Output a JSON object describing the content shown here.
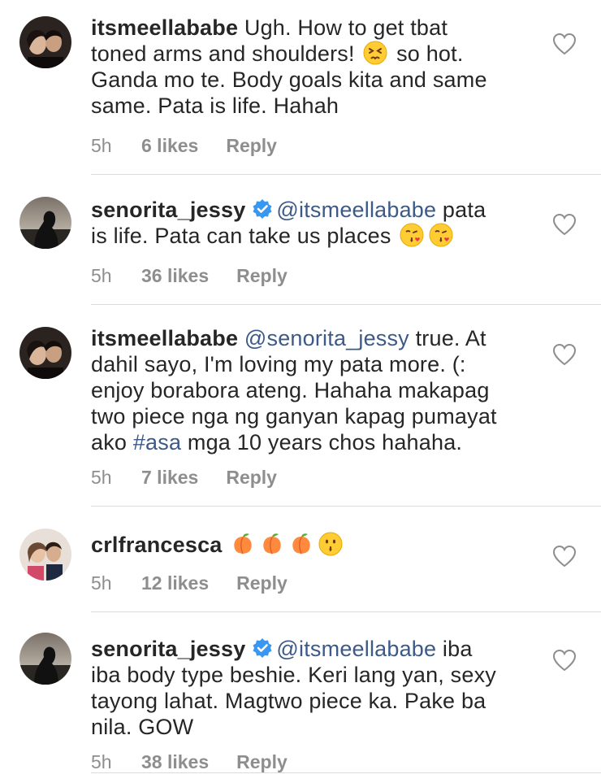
{
  "comments": [
    {
      "avatar_icon": "avatar-photo-couple",
      "username": "itsmeellababe",
      "verified": false,
      "lines": [
        [
          "Ugh. How to get tbat"
        ],
        [
          "toned arms and shoulders! ",
          "{emoji:persevering-face}",
          " so hot."
        ],
        [
          "Ganda mo te. Body goals kita and same"
        ],
        [
          "same. Pata is life. Hahah"
        ]
      ],
      "time": "5h",
      "likes": "6 likes",
      "reply": "Reply"
    },
    {
      "avatar_icon": "avatar-photo-silhouette",
      "username": "senorita_jessy",
      "verified": true,
      "lines": [
        [
          "{mention:@itsmeellababe}",
          " pata"
        ],
        [
          "is life. Pata can take us places ",
          "{emoji:face-blowing-kiss}",
          "{emoji:face-blowing-kiss}"
        ]
      ],
      "time": "5h",
      "likes": "36 likes",
      "reply": "Reply"
    },
    {
      "avatar_icon": "avatar-photo-couple",
      "username": "itsmeellababe",
      "verified": false,
      "lines": [
        [
          "{mention:@senorita_jessy}",
          " true. At"
        ],
        [
          "dahil sayo, I'm loving my pata more. (:"
        ],
        [
          "enjoy borabora ateng. Hahaha makapag"
        ],
        [
          "two piece nga ng ganyan kapag pumayat"
        ],
        [
          "ako ",
          "{tag:#asa}",
          " mga 10 years chos hahaha."
        ]
      ],
      "time": "5h",
      "likes": "7 likes",
      "reply": "Reply"
    },
    {
      "avatar_icon": "avatar-photo-group",
      "username": "crlfrancesca",
      "verified": false,
      "lines": [
        [
          "{emoji:peach}",
          "{emoji:peach}",
          "{emoji:peach}",
          "{emoji:kissing-face}"
        ]
      ],
      "time": "5h",
      "likes": "12 likes",
      "reply": "Reply"
    },
    {
      "avatar_icon": "avatar-photo-silhouette",
      "username": "senorita_jessy",
      "verified": true,
      "lines": [
        [
          "{mention:@itsmeellababe}",
          " iba"
        ],
        [
          "iba body type beshie. Keri lang yan, sexy"
        ],
        [
          "tayong lahat. Magtwo piece ka. Pake ba"
        ],
        [
          "nila. GOW"
        ]
      ],
      "time": "5h",
      "likes": "38 likes",
      "reply": "Reply"
    }
  ],
  "colors": {
    "text": "#262626",
    "meta": "#8e8e8e",
    "mention": "#3c5a87",
    "verified": "#3897f0",
    "divider": "#dbdbdb"
  }
}
